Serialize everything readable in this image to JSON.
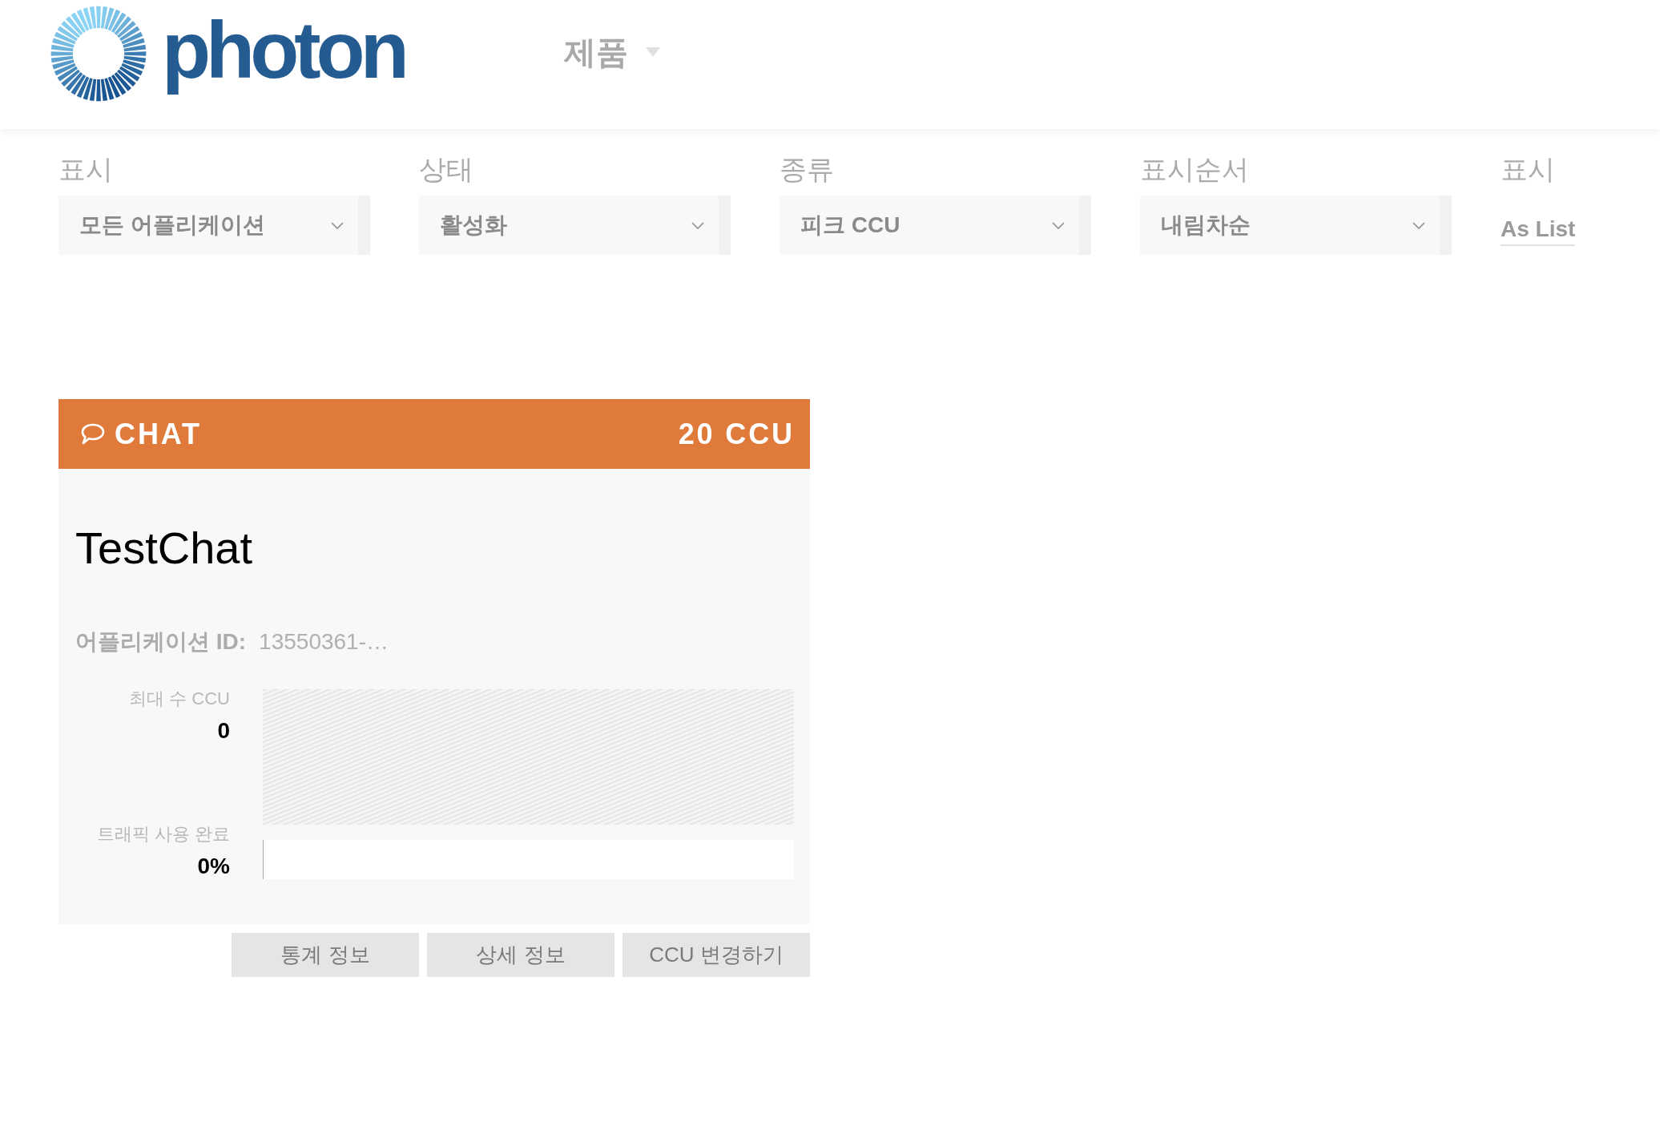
{
  "header": {
    "logo_text": "photon",
    "menu": [
      {
        "label": "제품"
      }
    ]
  },
  "filters": [
    {
      "kind": "select",
      "label": "표시",
      "value": "모든 어플리케이션"
    },
    {
      "kind": "select",
      "label": "상태",
      "value": "활성화"
    },
    {
      "kind": "select",
      "label": "종류",
      "value": "피크 CCU"
    },
    {
      "kind": "select",
      "label": "표시순서",
      "value": "내림차순"
    },
    {
      "kind": "link",
      "label": "표시",
      "value": "As List"
    }
  ],
  "apps": [
    {
      "product": "CHAT",
      "ccu": "20 CCU",
      "name": "TestChat",
      "id_label": "어플리케이션 ID:",
      "id_value": "13550361-…",
      "peak": {
        "label": "최대 수 CCU",
        "value": "0"
      },
      "traffic": {
        "label": "트래픽 사용 완료",
        "value": "0%",
        "level": 0
      },
      "buttons": [
        "통계 정보",
        "상세 정보",
        "CCU 변경하기"
      ]
    }
  ]
}
